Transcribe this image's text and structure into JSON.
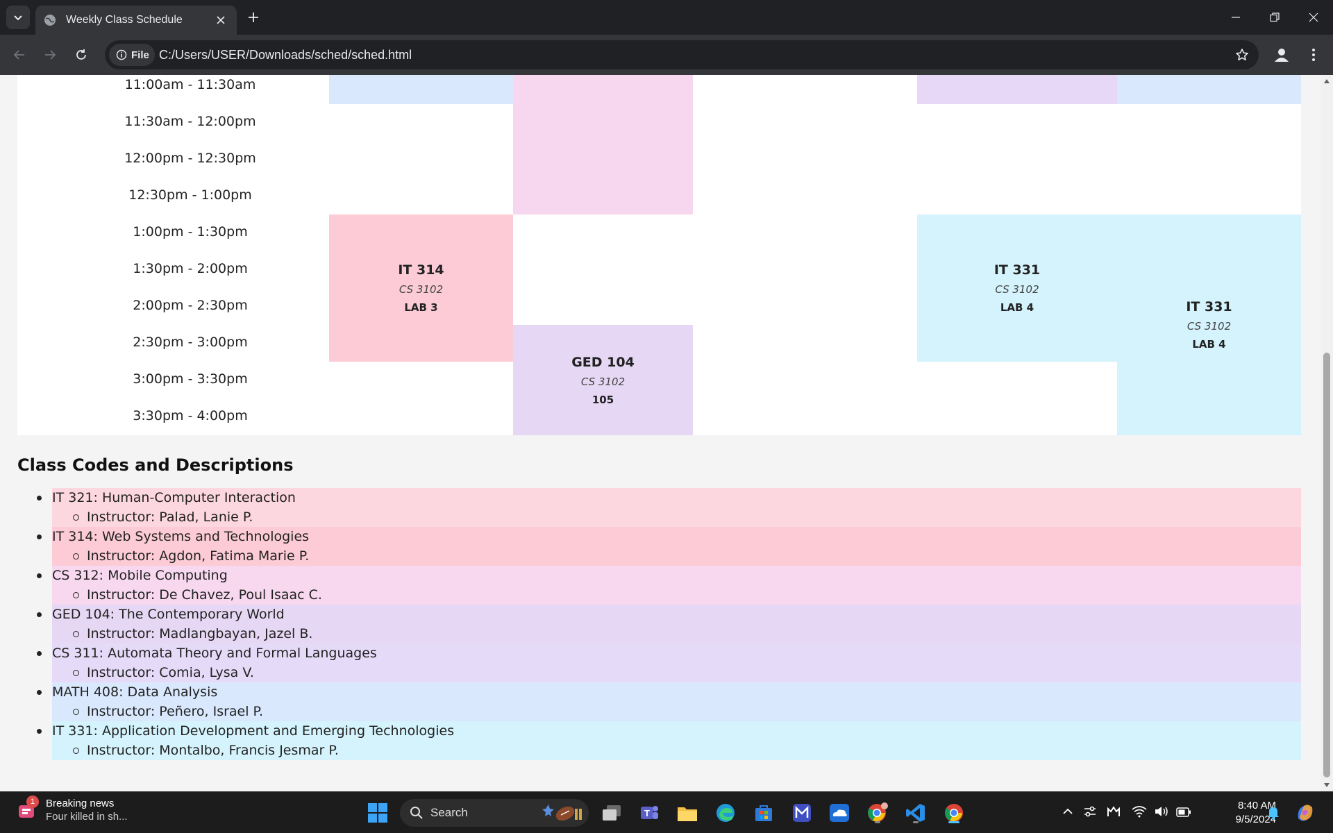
{
  "browser": {
    "tab_title": "Weekly Class Schedule",
    "chip_label": "File",
    "url": "C:/Users/USER/Downloads/sched/sched.html"
  },
  "schedule": {
    "times": [
      "11:00am - 11:30am",
      "11:30am - 12:00pm",
      "12:00pm - 12:30pm",
      "12:30pm - 1:00pm",
      "1:00pm - 1:30pm",
      "1:30pm - 2:00pm",
      "2:00pm - 2:30pm",
      "2:30pm - 3:00pm",
      "3:00pm - 3:30pm",
      "3:30pm - 4:00pm"
    ],
    "blocks": [
      {
        "code": "IT 314",
        "section": "CS 3102",
        "room": "LAB 3",
        "color": "#fccbd6"
      },
      {
        "code": "GED 104",
        "section": "CS 3102",
        "room": "105",
        "color": "#e6d8f4"
      },
      {
        "code": "IT 331",
        "section": "CS 3102",
        "room": "LAB 4",
        "color": "#d4f3fc"
      },
      {
        "code": "IT 331",
        "section": "CS 3102",
        "room": "LAB 4",
        "color": "#d4f3fc"
      }
    ],
    "colors": {
      "light_blue": "#d9e8fd",
      "pink": "#f7d6ef",
      "lavender": "#e6d8f6"
    }
  },
  "descriptions": {
    "heading": "Class Codes and Descriptions",
    "items": [
      {
        "course": "IT 321: Human-Computer Interaction",
        "instructor": "Instructor: Palad, Lanie P.",
        "color": "#fdd7df"
      },
      {
        "course": "IT 314: Web Systems and Technologies",
        "instructor": "Instructor: Agdon, Fatima Marie P.",
        "color": "#fccbd6"
      },
      {
        "course": "CS 312: Mobile Computing",
        "instructor": "Instructor: De Chavez, Poul Isaac C.",
        "color": "#f7d8ef"
      },
      {
        "course": "GED 104: The Contemporary World",
        "instructor": "Instructor: Madlangbayan, Jazel B.",
        "color": "#e6d8f4"
      },
      {
        "course": "CS 311: Automata Theory and Formal Languages",
        "instructor": "Instructor: Comia, Lysa V.",
        "color": "#e5dbf8"
      },
      {
        "course": "MATH 408: Data Analysis",
        "instructor": "Instructor: Peñero, Israel P.",
        "color": "#d9e8fd"
      },
      {
        "course": "IT 331: Application Development and Emerging Technologies",
        "instructor": "Instructor: Montalbo, Francis Jesmar P.",
        "color": "#d4f3fc"
      }
    ]
  },
  "taskbar": {
    "news_badge": "1",
    "news_title": "Breaking news",
    "news_sub": "Four killed in sh...",
    "search_label": "Search",
    "time": "8:40 AM",
    "date": "9/5/2024"
  }
}
